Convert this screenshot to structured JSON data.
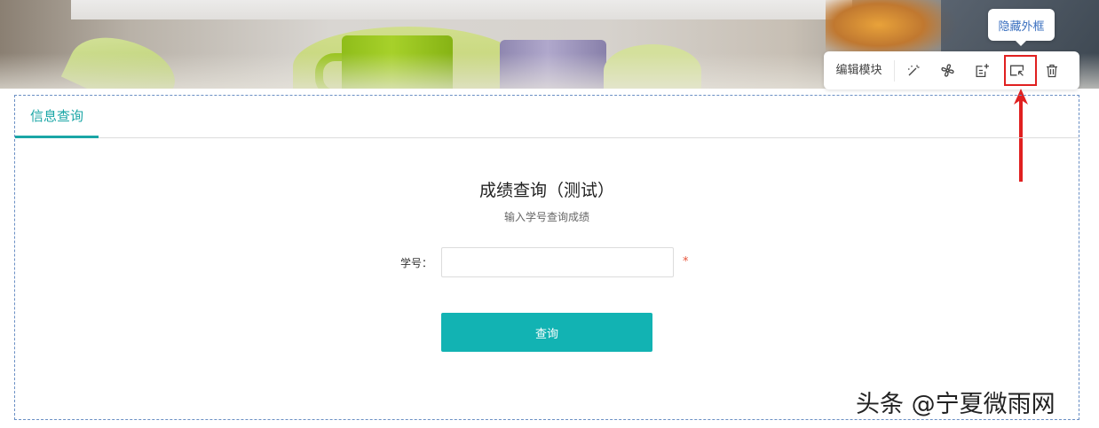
{
  "toolbar": {
    "tooltip": "隐藏外框",
    "edit_label": "编辑模块",
    "icons": [
      "magic-wand-icon",
      "fan-icon",
      "add-section-icon",
      "hide-frame-icon",
      "trash-icon"
    ]
  },
  "module": {
    "tab_label": "信息查询",
    "form_title": "成绩查询（测试）",
    "form_subtitle": "输入学号查询成绩",
    "field_label": "学号：",
    "field_value": "",
    "required_mark": "*",
    "submit_label": "查询"
  },
  "watermark": "头条 @宁夏微雨网",
  "colors": {
    "accent": "#12b3b3",
    "tab_accent": "#1aa6a6",
    "highlight": "#e02020",
    "tooltip_text": "#3a6fbf"
  }
}
